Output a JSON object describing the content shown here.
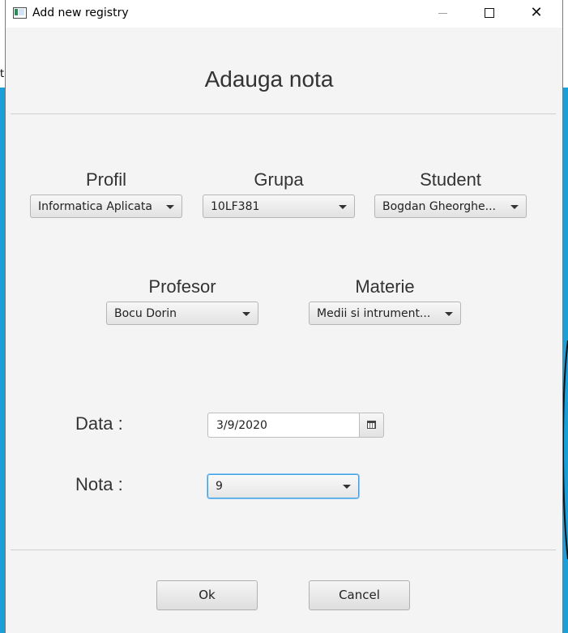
{
  "background": {
    "partial_letter": "t"
  },
  "window": {
    "title": "Add new registry",
    "close_glyph": "✕"
  },
  "form": {
    "heading": "Adauga nota",
    "profil": {
      "label": "Profil",
      "value": "Informatica Aplicata"
    },
    "grupa": {
      "label": "Grupa",
      "value": "10LF381"
    },
    "student": {
      "label": "Student",
      "value": "Bogdan Gheorghe..."
    },
    "profesor": {
      "label": "Profesor",
      "value": "Bocu Dorin"
    },
    "materie": {
      "label": "Materie",
      "value": "Medii si intrument..."
    },
    "data": {
      "label": "Data :",
      "value": "3/9/2020"
    },
    "nota": {
      "label": "Nota :",
      "value": "9"
    }
  },
  "buttons": {
    "ok": "Ok",
    "cancel": "Cancel"
  },
  "colors": {
    "background_window": "#1a9fd9",
    "focus_ring": "#3b9fe3",
    "dialog_bg": "#f4f4f4"
  },
  "icons": [
    "app-window-icon",
    "minimize-icon",
    "maximize-icon",
    "close-icon",
    "chevron-down-icon",
    "calendar-icon"
  ]
}
